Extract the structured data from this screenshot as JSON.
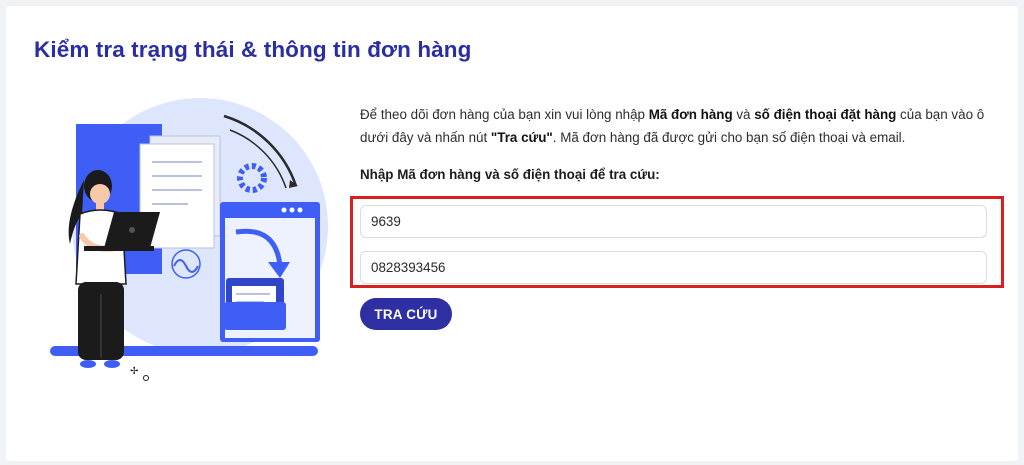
{
  "page": {
    "title": "Kiểm tra trạng thái & thông tin đơn hàng"
  },
  "intro": {
    "p1": "Để theo dõi đơn hàng của bạn xin vui lòng nhập ",
    "b1": "Mã đơn hàng",
    "p2": " và ",
    "b2": "số điện thoại đặt hàng",
    "p3": " của bạn vào ô dưới đây và nhấn nút ",
    "b3": "\"Tra cứu\"",
    "p4": ". Mã đơn hàng đã được gửi cho bạn số điện thoại và email."
  },
  "form": {
    "instruction": "Nhập Mã đơn hàng và số điện thoại để tra cứu:",
    "order_code": "9639",
    "phone": "0828393456",
    "submit_label": "TRA CỨU"
  },
  "colors": {
    "accent": "#2b2ea3",
    "highlight": "#d8201f",
    "illustration_blue": "#3f5ef5"
  },
  "icons": [
    "document-icon",
    "gear-icon",
    "folder-icon",
    "laptop-icon",
    "arrow-icon"
  ]
}
